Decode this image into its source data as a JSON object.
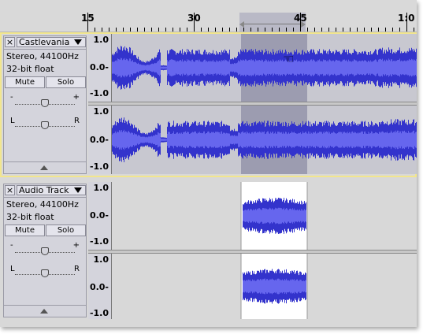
{
  "ruler": {
    "labels": [
      "15",
      "30",
      "45",
      "1:0"
    ]
  },
  "tracks": [
    {
      "close": "×",
      "name": "Castlevania",
      "info1": "Stereo, 44100Hz",
      "info2": "32-bit float",
      "mute": "Mute",
      "solo": "Solo",
      "gain_minus": "-",
      "gain_plus": "+",
      "pan_left": "L",
      "pan_right": "R",
      "selected": true,
      "channels": [
        {
          "ymax": "1.0",
          "ymid": "0.0-",
          "ymin": "-1.0"
        },
        {
          "ymax": "1.0",
          "ymid": "0.0-",
          "ymin": "-1.0"
        }
      ]
    },
    {
      "close": "×",
      "name": "Audio Track",
      "info1": "Stereo, 44100Hz",
      "info2": "32-bit float",
      "mute": "Mute",
      "solo": "Solo",
      "gain_minus": "-",
      "gain_plus": "+",
      "pan_left": "L",
      "pan_right": "R",
      "selected": false,
      "channels": [
        {
          "ymax": "1.0",
          "ymid": "0.0-",
          "ymin": "-1.0"
        },
        {
          "ymax": "1.0",
          "ymid": "0.0-",
          "ymin": "-1.0"
        }
      ]
    }
  ],
  "colors": {
    "waveform": "#3333cc",
    "waveform_rms": "#6666ee",
    "selected_bg": "#c8c8d0",
    "selected_sel_bg": "#9c9cb0",
    "unselected_bg": "#d8d8d8",
    "unselected_sel_bg": "#ffffff",
    "selection_border": "#f2e68d"
  },
  "icons": {
    "close": "close-icon",
    "menu": "chevron-down-icon",
    "collapse": "collapse-up-icon",
    "cursor": "pointing-hand-icon"
  }
}
